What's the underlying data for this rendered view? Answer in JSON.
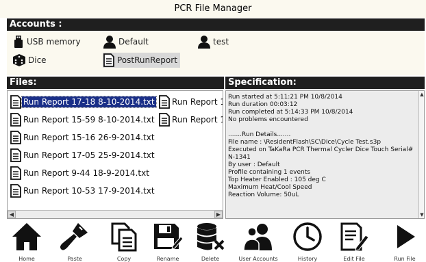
{
  "window": {
    "title": "PCR File Manager"
  },
  "accounts": {
    "header": "Accounts :",
    "items": [
      {
        "label": "USB memory",
        "icon": "usb-memory-icon"
      },
      {
        "label": "Default",
        "icon": "user-icon"
      },
      {
        "label": "test",
        "icon": "user-icon"
      },
      {
        "label": "Dice",
        "icon": "dice-icon"
      },
      {
        "label": "PostRunReport",
        "icon": "document-icon",
        "selected": true
      }
    ]
  },
  "files": {
    "header": "Files:",
    "items": [
      {
        "label": "Run Report 17-18 8-10-2014.txt",
        "selected": true
      },
      {
        "label": "Run Report 15-59 8-10-2014.txt"
      },
      {
        "label": "Run Report 15-16 26-9-2014.txt"
      },
      {
        "label": "Run Report 17-05 25-9-2014.txt"
      },
      {
        "label": "Run Report 9-44 18-9-2014.txt"
      },
      {
        "label": "Run Report 10-53 17-9-2014.txt"
      },
      {
        "label": "Run Report 1"
      },
      {
        "label": "Run Report 1"
      }
    ]
  },
  "specification": {
    "header": "Specification:",
    "lines": [
      "Run started at 5:11:21 PM 10/8/2014",
      "Run duration 00:03:12",
      "Run completed at 5:14:33 PM 10/8/2014",
      "No problems encountered",
      "",
      ".......Run Details.......",
      "File name : \\ResidentFlash\\SC\\Dice\\Cycle Test.s3p",
      "Executed on TaKaRa PCR Thermal Cycler Dice Touch Serial#",
      "N-1341",
      "By user : Default",
      "Profile containing 1 events",
      "Top Heater Enabled : 105 deg C",
      "Maximum Heat/Cool Speed",
      "Reaction Volume: 50uL"
    ]
  },
  "toolbar": {
    "items": [
      {
        "label": "Home",
        "icon": "home-icon"
      },
      {
        "label": "Paste",
        "icon": "paste-brush-icon"
      },
      {
        "label": "Copy",
        "icon": "copy-icon"
      },
      {
        "label": "Rename",
        "icon": "rename-floppy-icon"
      },
      {
        "label": "Delete",
        "icon": "delete-database-icon"
      },
      {
        "label": "User Accounts",
        "icon": "user-accounts-icon"
      },
      {
        "label": "History",
        "icon": "history-clock-icon"
      },
      {
        "label": "Edit File",
        "icon": "edit-file-icon"
      },
      {
        "label": "Run File",
        "icon": "run-play-icon"
      }
    ]
  },
  "colors": {
    "header_bg": "#1f1f1f",
    "selection": "#1a2f88",
    "panel_bg": "#fbf9ef"
  }
}
